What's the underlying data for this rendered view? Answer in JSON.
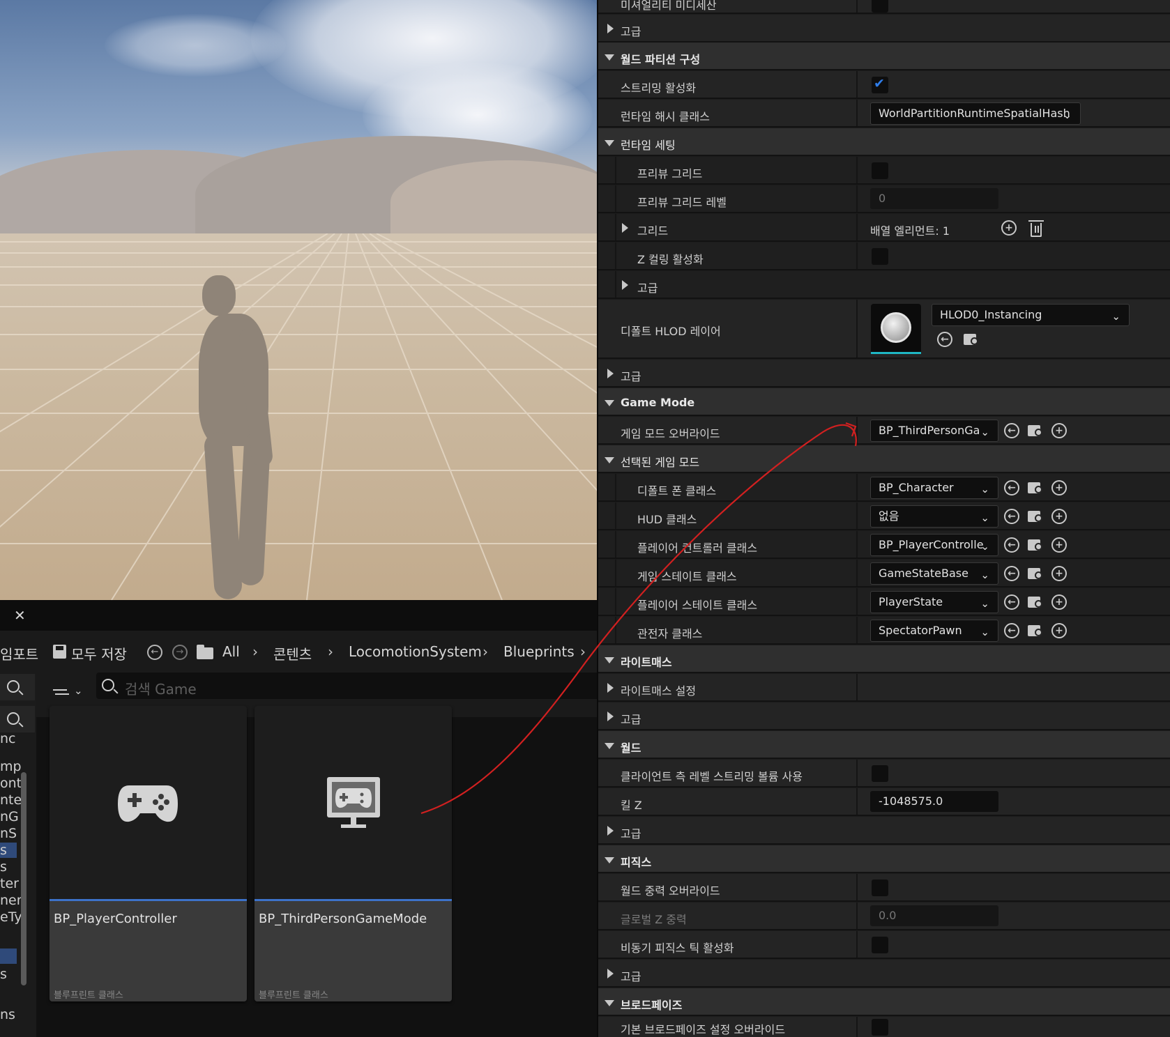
{
  "content_browser": {
    "close_glyph": "✕",
    "toolbar": {
      "import_frag": "임포트",
      "save_all": "모두 저장",
      "breadcrumbs": [
        "All",
        "콘텐츠",
        "LocomotionSystem",
        "Blueprints"
      ]
    },
    "search_placeholder": "검색 Game",
    "sidebar_fragments": [
      "nc",
      "mp",
      "ont",
      "nte",
      "nG",
      "nS",
      "s",
      "s",
      "ter",
      "ner",
      "eTy",
      "s",
      "ns"
    ],
    "assets": [
      {
        "name": "BP_PlayerController",
        "type": "블루프린트 클래스",
        "icon": "gamepad-icon"
      },
      {
        "name": "BP_ThirdPersonGameMode",
        "type": "블루프린트 클래스",
        "icon": "monitor-gamepad-icon"
      }
    ]
  },
  "details": {
    "top_partial": "미셔얼리티 미디세산",
    "advanced_1": "고급",
    "wp_category": "월드 파티션 구성",
    "streaming_enable": "스트리밍 활성화",
    "runtime_hash_label": "런타임 해시 클래스",
    "runtime_hash_value": "WorldPartitionRuntimeSpatialHash",
    "runtime_settings": "런타임 세팅",
    "preview_grid": "프리뷰 그리드",
    "preview_grid_level": "프리뷰 그리드 레벨",
    "preview_grid_level_value": "0",
    "grid": "그리드",
    "array_elements": "배열 엘리먼트: 1",
    "z_culling": "Z 컬링 활성화",
    "advanced_2": "고급",
    "default_hlod_label": "디폴트 HLOD 레이어",
    "default_hlod_value": "HLOD0_Instancing",
    "advanced_3": "고급",
    "game_mode_category": "Game Mode",
    "game_mode_override": "게임 모드 오버라이드",
    "game_mode_override_value": "BP_ThirdPersonGa",
    "selected_game_mode": "선택된 게임 모드",
    "gm_rows": [
      {
        "label": "디폴트 폰 클래스",
        "value": "BP_Character"
      },
      {
        "label": "HUD 클래스",
        "value": "없음"
      },
      {
        "label": "플레이어 컨트롤러 클래스",
        "value": "BP_PlayerControlle"
      },
      {
        "label": "게임 스테이트 클래스",
        "value": "GameStateBase"
      },
      {
        "label": "플레이어 스테이트 클래스",
        "value": "PlayerState"
      },
      {
        "label": "관전자 클래스",
        "value": "SpectatorPawn"
      }
    ],
    "lightmass_category": "라이트매스",
    "lightmass_settings": "라이트매스 설정",
    "advanced_4": "고급",
    "world_category": "월드",
    "client_streaming": "클라이언트 측 레벨 스트리밍 볼륨 사용",
    "kill_z": "킬 Z",
    "kill_z_value": "-1048575.0",
    "advanced_5": "고급",
    "physics_category": "피직스",
    "gravity_override": "월드 중력 오버라이드",
    "global_gravity_z": "글로벌 Z 중력",
    "global_gravity_z_value": "0.0",
    "async_physics": "비동기 피직스 틱 활성화",
    "advanced_6": "고급",
    "broadphase_category": "브로드페이즈",
    "broadphase_override": "기본 브로드페이즈 설정 오버라이드",
    "states": {
      "streaming_enable": true,
      "preview_grid": false,
      "z_culling": false,
      "client_streaming": false,
      "gravity_override": false,
      "async_physics": false,
      "broadphase_override": false
    }
  },
  "colors": {
    "accent_blue": "#2f7de9",
    "annotation_red": "#d22020",
    "hlod_underline": "#1fb7c4"
  }
}
